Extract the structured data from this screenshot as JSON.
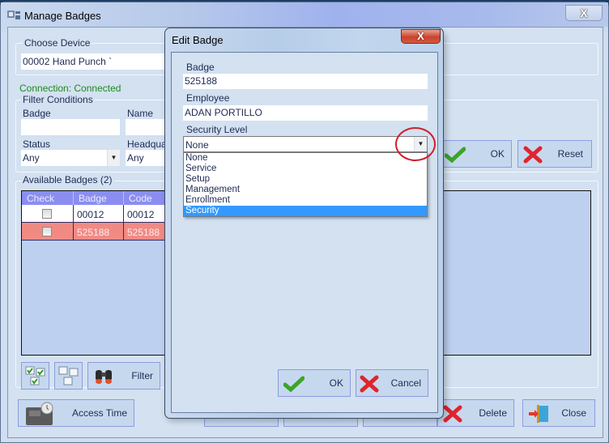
{
  "main_window": {
    "title": "Manage Badges",
    "close_glyph": "X",
    "choose_device": {
      "label": "Choose Device",
      "value": "00002  Hand Punch `"
    },
    "connection_status": "Connection: Connected",
    "connection_color": "#1c8a1c",
    "filter_conditions": {
      "label": "Filter Conditions",
      "badge_label": "Badge",
      "badge_value": "",
      "name_label": "Name",
      "name_value": "",
      "status_label": "Status",
      "status_value": "Any",
      "headquarters_label": "Headquar",
      "headquarters_value": "Any",
      "ok_label": "OK",
      "reset_label": "Reset"
    },
    "available_badges": {
      "label": "Available Badges (2)",
      "columns": [
        "Check",
        "Badge",
        "Code"
      ],
      "rows": [
        {
          "checked": false,
          "badge": "00012",
          "code": "00012",
          "highlighted": false
        },
        {
          "checked": false,
          "badge": "525188",
          "code": "525188",
          "highlighted": true
        }
      ],
      "highlight_color": "#f28a84",
      "header_color": "#8b8ef0"
    },
    "buttons": {
      "select_all_icon": "check-all-icon",
      "deselect_all_icon": "uncheck-all-icon",
      "filter_label": "Filter",
      "access_time_label": "Access Time",
      "delete_label": "Delete",
      "close_label": "Close"
    }
  },
  "edit_badge_dialog": {
    "title": "Edit Badge",
    "close_glyph": "X",
    "badge_label": "Badge",
    "badge_value": "525188",
    "employee_label": "Employee",
    "employee_value": "ADAN PORTILLO",
    "security_level_label": "Security Level",
    "security_level_value": "None",
    "security_level_options": [
      "None",
      "Service",
      "Setup",
      "Management",
      "Enrollment",
      "Security"
    ],
    "highlighted_option": "Security",
    "ok_label": "OK",
    "cancel_label": "Cancel"
  },
  "annotation": {
    "type": "red-circle",
    "color": "#d1202a",
    "target": "security-level-dropdown-arrow"
  }
}
